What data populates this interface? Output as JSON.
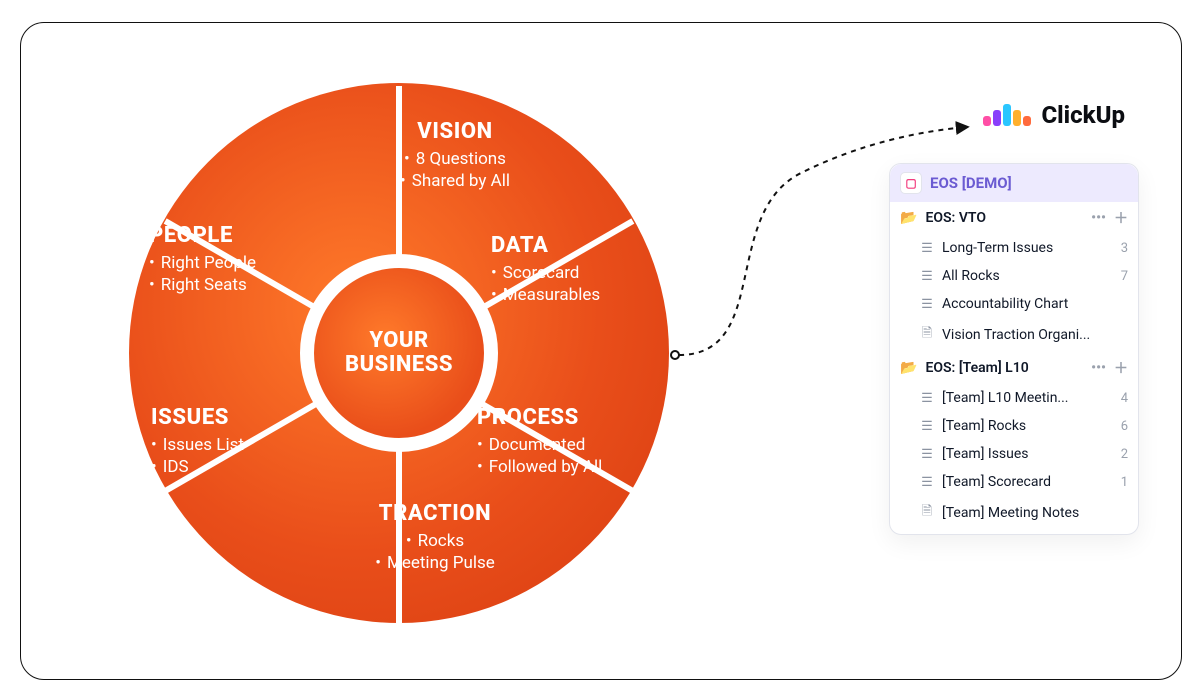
{
  "wheel": {
    "center_line1": "YOUR",
    "center_line2": "BUSINESS",
    "segments": {
      "vision": {
        "title": "VISION",
        "lines": [
          "8 Questions",
          "Shared by All"
        ]
      },
      "data": {
        "title": "DATA",
        "lines": [
          "Scorecard",
          "Measurables"
        ]
      },
      "process": {
        "title": "PROCESS",
        "lines": [
          "Documented",
          "Followed by All"
        ]
      },
      "traction": {
        "title": "TRACTION",
        "lines": [
          "Rocks",
          "Meeting Pulse"
        ]
      },
      "issues": {
        "title": "ISSUES",
        "lines": [
          "Issues List",
          "IDS"
        ]
      },
      "people": {
        "title": "PEOPLE",
        "lines": [
          "Right People",
          "Right Seats"
        ]
      }
    }
  },
  "brand": {
    "name": "ClickUp"
  },
  "space": {
    "root": "EOS [DEMO]",
    "folders": [
      {
        "name": "EOS: VTO",
        "items": [
          {
            "icon": "list",
            "label": "Long-Term Issues",
            "count": "3"
          },
          {
            "icon": "list",
            "label": "All Rocks",
            "count": "7"
          },
          {
            "icon": "list",
            "label": "Accountability Chart",
            "count": ""
          },
          {
            "icon": "doc",
            "label": "Vision Traction Organi...",
            "count": ""
          }
        ]
      },
      {
        "name": "EOS: [Team] L10",
        "items": [
          {
            "icon": "list",
            "label": "[Team] L10 Meetin...",
            "count": "4"
          },
          {
            "icon": "list",
            "label": "[Team] Rocks",
            "count": "6"
          },
          {
            "icon": "list",
            "label": "[Team] Issues",
            "count": "2"
          },
          {
            "icon": "list",
            "label": "[Team] Scorecard",
            "count": "1"
          },
          {
            "icon": "doc",
            "label": "[Team] Meeting Notes",
            "count": ""
          }
        ]
      }
    ]
  }
}
